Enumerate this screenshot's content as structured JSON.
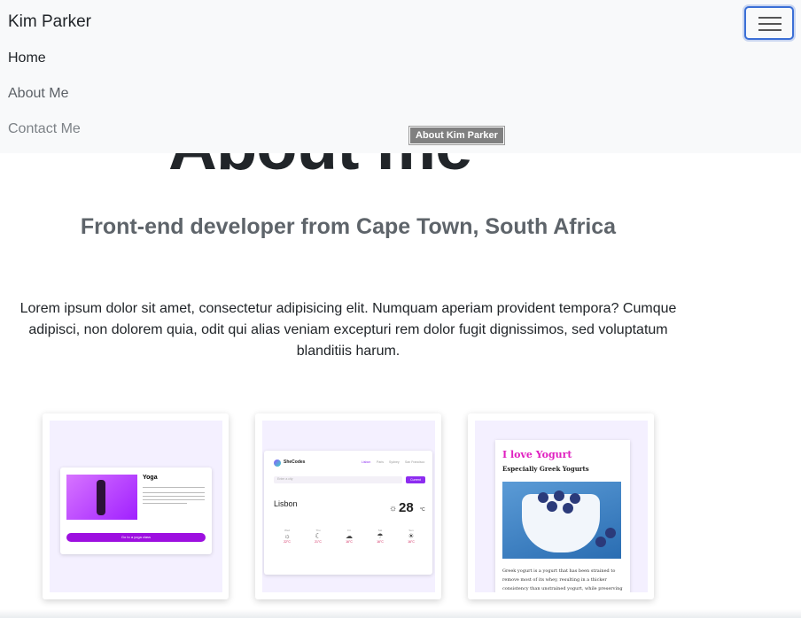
{
  "navbar": {
    "brand": "Kim Parker",
    "links": [
      "Home",
      "About Me",
      "Contact Me"
    ]
  },
  "tooltip": "About Kim Parker",
  "hero": {
    "title": "About me",
    "subtitle": "Front-end developer from Cape Town, South Africa",
    "paragraph": "Lorem ipsum dolor sit amet, consectetur adipisicing elit. Numquam aperiam provident tempora? Cumque adipisci, non dolorem quia, odit qui alias veniam excepturi rem dolor fugit dignissimos, sed voluptatum blanditiis harum."
  },
  "projects": {
    "yoga": {
      "title": "Yoga",
      "button": "Go to a yoga class"
    },
    "weather": {
      "brand": "SheCodes",
      "nav": [
        "Lisbon",
        "Paris",
        "Sydney",
        "San Francisco"
      ],
      "search_placeholder": "Enter a city",
      "search_button": "Current",
      "city": "Lisbon",
      "temperature": "28",
      "unit": "°C",
      "forecast": [
        {
          "day": "Wed",
          "icon": "☼",
          "temp": "22°C"
        },
        {
          "day": "Thu",
          "icon": "☾",
          "temp": "21°C"
        },
        {
          "day": "Fri",
          "icon": "☁",
          "temp": "16°C"
        },
        {
          "day": "Sat",
          "icon": "☂",
          "temp": "16°C"
        },
        {
          "day": "Sun",
          "icon": "☀",
          "temp": "16°C"
        }
      ]
    },
    "yogurt": {
      "title": "I love Yogurt",
      "subtitle": "Especially Greek Yogurts",
      "text": "Greek yogurt is a yogurt that has been strained to remove most of its whey, resulting in a thicker consistency than unstrained yogurt, while preserving yogurt's distinctive sour taste. Like many types of yogurt, strained yogurt is"
    }
  },
  "colors": {
    "accent": "#3b6fd6",
    "yoga_purple": "#9d0fe0",
    "yogurt_pink": "#e020c0"
  }
}
